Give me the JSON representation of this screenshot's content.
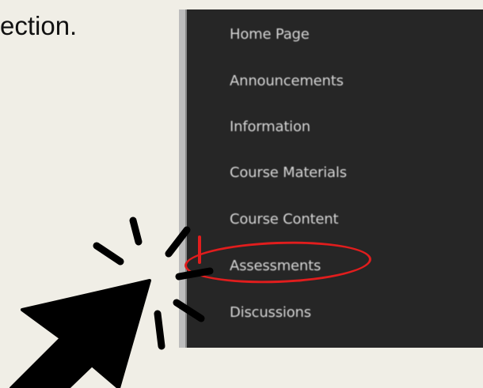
{
  "instruction": {
    "text": "ection."
  },
  "nav": {
    "items": [
      {
        "label": "Home Page",
        "highlighted": false
      },
      {
        "label": "Announcements",
        "highlighted": false
      },
      {
        "label": "Information",
        "highlighted": false
      },
      {
        "label": "Course Materials",
        "highlighted": false
      },
      {
        "label": "Course Content",
        "highlighted": false
      },
      {
        "label": "Assessments",
        "highlighted": true
      },
      {
        "label": "Discussions",
        "highlighted": false
      }
    ]
  },
  "colors": {
    "page_background": "#f0eee6",
    "nav_background": "#262626",
    "nav_text": "#d6d6d6",
    "highlight": "#e11d1d",
    "cursor": "#000000"
  },
  "icons": {
    "pointer": "click-cursor-icon"
  }
}
